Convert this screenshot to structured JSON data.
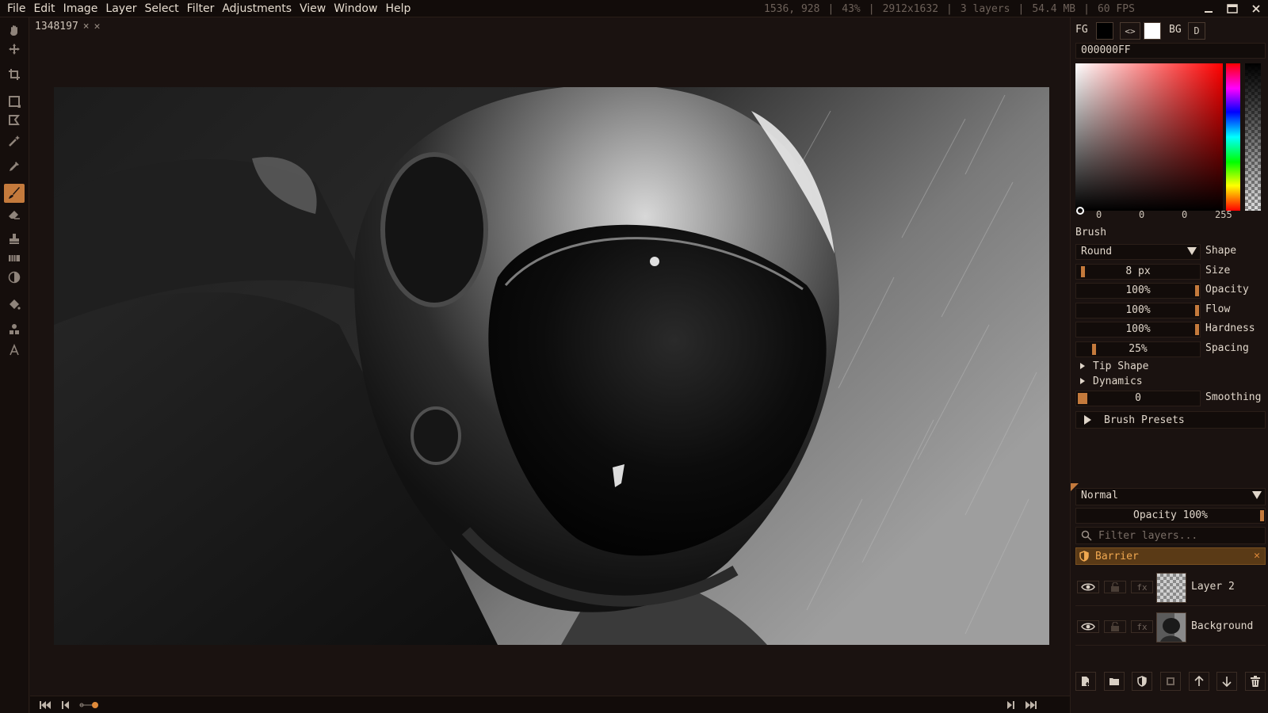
{
  "menu": [
    "File",
    "Edit",
    "Image",
    "Layer",
    "Select",
    "Filter",
    "Adjustments",
    "View",
    "Window",
    "Help"
  ],
  "status": {
    "cursor": "1536, 928",
    "zoom": "43%",
    "dimensions": "2912x1632",
    "layers": "3 layers",
    "memory": "54.4 MB",
    "fps": "60 FPS"
  },
  "window_controls": {
    "minimize": "—",
    "maximize": "▭",
    "close": "✕"
  },
  "document": {
    "tab_name": "1348197",
    "tab_close": "×",
    "tab_close2": "✕"
  },
  "tools": [
    {
      "name": "hand-tool",
      "icon": "hand-icon"
    },
    {
      "name": "move-tool",
      "icon": "move-icon"
    },
    {
      "name": "crop-tool",
      "icon": "crop-icon"
    },
    {
      "name": "rect-select-tool",
      "icon": "rect-select-icon"
    },
    {
      "name": "lasso-tool",
      "icon": "lasso-icon"
    },
    {
      "name": "magic-wand-tool",
      "icon": "magic-wand-icon"
    },
    {
      "name": "eyedropper-tool",
      "icon": "eyedropper-icon"
    },
    {
      "name": "brush-tool",
      "icon": "brush-icon",
      "active": true
    },
    {
      "name": "eraser-tool",
      "icon": "eraser-icon"
    },
    {
      "name": "clone-stamp-tool",
      "icon": "stamp-icon"
    },
    {
      "name": "gradient-tool",
      "icon": "gradient-icon"
    },
    {
      "name": "dodge-burn-tool",
      "icon": "contrast-icon"
    },
    {
      "name": "fill-tool",
      "icon": "bucket-icon"
    },
    {
      "name": "shape-tool",
      "icon": "shapes-icon"
    },
    {
      "name": "text-tool",
      "icon": "text-icon"
    }
  ],
  "colors": {
    "fg_label": "FG",
    "bg_label": "BG",
    "swap_label": "<>",
    "default_label": "D",
    "fg_color": "#000000",
    "bg_color": "#ffffff",
    "hex": "000000FF",
    "r": "0",
    "g": "0",
    "b": "0",
    "a": "255",
    "accent": "#c47a3c"
  },
  "brush": {
    "title": "Brush",
    "shape": {
      "value": "Round",
      "label": "Shape"
    },
    "size": {
      "value": "8 px",
      "label": "Size",
      "level": 0.01
    },
    "opacity": {
      "value": "100%",
      "label": "Opacity",
      "level": 1.0
    },
    "flow": {
      "value": "100%",
      "label": "Flow",
      "level": 1.0
    },
    "hardness": {
      "value": "100%",
      "label": "Hardness",
      "level": 1.0
    },
    "spacing": {
      "value": "25%",
      "label": "Spacing",
      "level": 0.1
    },
    "tip_shape": "Tip Shape",
    "dynamics": "Dynamics",
    "smoothing": {
      "value": "0",
      "label": "Smoothing",
      "level": 0.0
    },
    "presets": "Brush Presets"
  },
  "layers_panel": {
    "blend_mode": "Normal",
    "opacity": "Opacity 100%",
    "filter_placeholder": "Filter layers...",
    "barrier": {
      "label": "Barrier",
      "close": "✕"
    },
    "fx_label": "fx",
    "layers": [
      {
        "name": "Layer 2",
        "thumbnail": "transparent"
      },
      {
        "name": "Background",
        "thumbnail": "astronaut"
      }
    ]
  }
}
